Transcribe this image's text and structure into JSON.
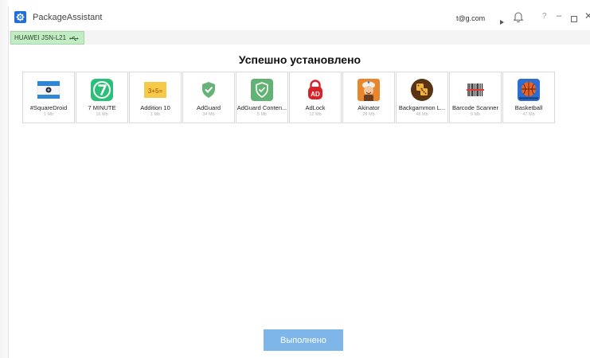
{
  "window": {
    "title": "PackageAssistant"
  },
  "titlebar": {
    "email": "t@g.com"
  },
  "device": {
    "name": "HUAWEI JSN-L21"
  },
  "main": {
    "heading": "Успешно установлено",
    "apps": [
      {
        "name": "#SquareDroid",
        "size": "1 Mb"
      },
      {
        "name": "7 MINUTE",
        "size": "16 Mb"
      },
      {
        "name": "Addition 10",
        "size": "1 Mb"
      },
      {
        "name": "AdGuard",
        "size": "34 Mb"
      },
      {
        "name": "AdGuard Conten...",
        "size": "5 Mb"
      },
      {
        "name": "AdLock",
        "size": "12 Mb"
      },
      {
        "name": "Akinator",
        "size": "28 Mb"
      },
      {
        "name": "Backgammon L...",
        "size": "48 Mb"
      },
      {
        "name": "Barcode Scanner",
        "size": "9 Mb"
      },
      {
        "name": "Basketball",
        "size": "47 Mb"
      }
    ],
    "done_label": "Выполнено"
  },
  "colors": {
    "accent": "#1e6fd9",
    "device_chip": "#c5ebc6",
    "done_button": "#7fb6ea"
  }
}
